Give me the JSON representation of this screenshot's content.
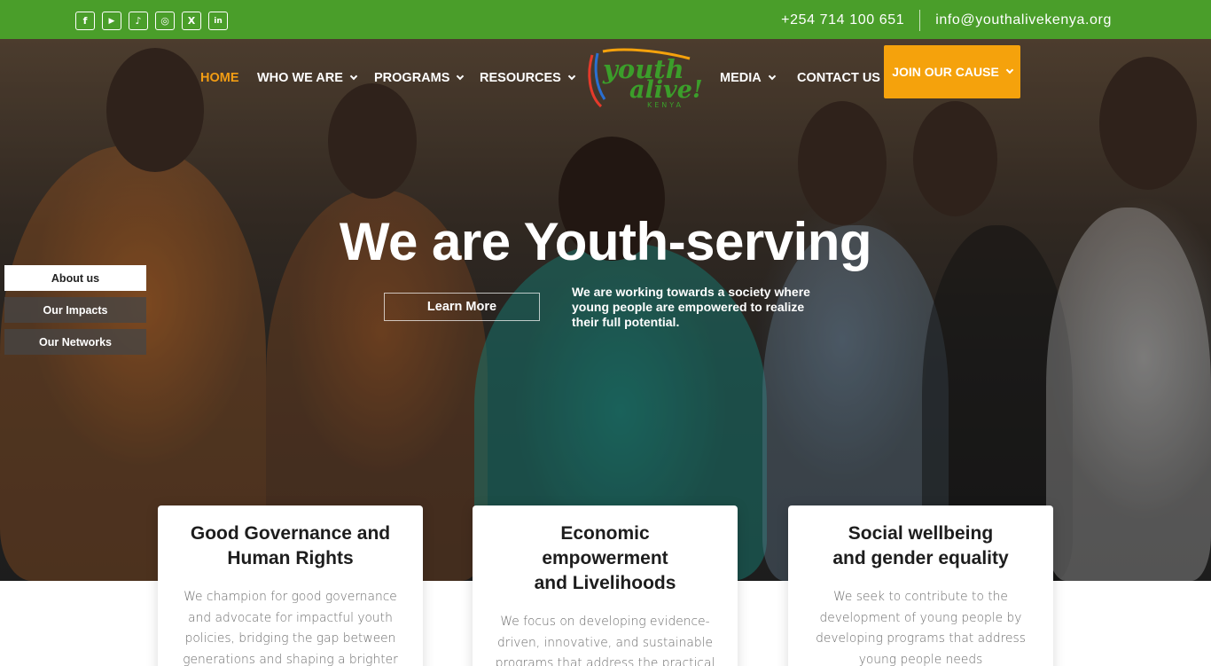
{
  "topbar": {
    "socials": [
      {
        "name": "facebook-icon",
        "glyph": "f"
      },
      {
        "name": "youtube-icon",
        "glyph": "▶"
      },
      {
        "name": "tiktok-icon",
        "glyph": "♪"
      },
      {
        "name": "instagram-icon",
        "glyph": "◎"
      },
      {
        "name": "x-icon",
        "glyph": "X"
      },
      {
        "name": "linkedin-icon",
        "glyph": "in"
      }
    ],
    "phone": "+254 714 100 651",
    "email": "info@youthalivekenya.org"
  },
  "nav": {
    "home": "HOME",
    "who_we_are": "WHO WE ARE",
    "programs": "PROGRAMS",
    "resources": "RESOURCES",
    "media": "MEDIA",
    "contact": "CONTACT US",
    "join": "JOIN OUR CAUSE"
  },
  "logo": {
    "line1": "youth",
    "line2": "alive!",
    "line3": "KENYA"
  },
  "hero": {
    "headline": "We are Youth-serving",
    "learn_more": "Learn More",
    "tagline": "We are working towards a society where young people are empowered to realize their full potential."
  },
  "side_tabs": [
    "About us",
    "Our Impacts",
    "Our Networks"
  ],
  "cards": [
    {
      "title": "Good Governance and\nHuman Rights",
      "desc": "We champion for good governance and advocate for impactful youth policies, bridging the gap between generations and shaping a brighter future."
    },
    {
      "title": "Economic\nempowerment\nand Livelihoods",
      "desc": "We focus on developing evidence-driven, innovative, and sustainable programs that address the practical needs of"
    },
    {
      "title": "Social wellbeing\nand gender equality",
      "desc": "We seek to contribute to the development of young people by developing programs that address young people needs"
    }
  ],
  "colors": {
    "topbar": "#4a9e2a",
    "accent": "#f5a20c",
    "active_nav": "#f29d13"
  }
}
